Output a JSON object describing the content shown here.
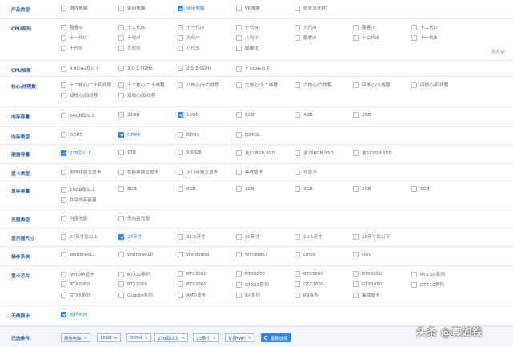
{
  "filters": [
    {
      "label": "产品类型",
      "options": [
        {
          "text": "游戏电脑",
          "checked": false
        },
        {
          "text": "家用电脑",
          "checked": false
        },
        {
          "text": "商用电脑",
          "checked": true
        },
        {
          "text": "VR电脑",
          "checked": false
        },
        {
          "text": "创意设计PC",
          "checked": false
        }
      ]
    },
    {
      "label": "CPU系列",
      "options": [
        {
          "text": "酷睿i9",
          "checked": false
        },
        {
          "text": "十二代i9",
          "checked": false
        },
        {
          "text": "十一代i9",
          "checked": false
        },
        {
          "text": "十代i9",
          "checked": false
        },
        {
          "text": "九代i9",
          "checked": false
        },
        {
          "text": "酷睿i7",
          "checked": false
        },
        {
          "text": "十二代i7",
          "checked": false
        },
        {
          "text": "十一代i7",
          "checked": false
        },
        {
          "text": "十代i7",
          "checked": false
        },
        {
          "text": "九代i7",
          "checked": false
        },
        {
          "text": "八代i7",
          "checked": false
        },
        {
          "text": "酷睿i5",
          "checked": false
        },
        {
          "text": "十二代i5",
          "checked": false
        },
        {
          "text": "十一代i5",
          "checked": false
        },
        {
          "text": "十代i5",
          "checked": false
        },
        {
          "text": "九代i5",
          "checked": false
        },
        {
          "text": "八代i5",
          "checked": false
        },
        {
          "text": "酷睿i3",
          "checked": false
        }
      ]
    },
    {
      "label": "CPU频率",
      "options": [
        {
          "text": "3.5GHz及以上",
          "checked": false
        },
        {
          "text": "3.0-3.5GHz",
          "checked": false
        },
        {
          "text": "2.5-3.0GHz",
          "checked": false
        },
        {
          "text": "2.5GHz以下",
          "checked": false
        }
      ]
    },
    {
      "label": "核心/线程数",
      "options": [
        {
          "text": "十二核心/二十四线程",
          "checked": false
        },
        {
          "text": "十二核心/二十线程",
          "checked": false
        },
        {
          "text": "八核心/十六线程",
          "checked": false
        },
        {
          "text": "六核心/十二线程",
          "checked": false
        },
        {
          "text": "六核心/六线程",
          "checked": false
        },
        {
          "text": "四核心/八线程",
          "checked": false
        },
        {
          "text": "四核心/四线程",
          "checked": false
        },
        {
          "text": "双核心/四线程",
          "checked": false
        },
        {
          "text": "双核心/双线程",
          "checked": false
        }
      ]
    },
    {
      "label": "内存容量",
      "options": [
        {
          "text": "64GB及以上",
          "checked": false
        },
        {
          "text": "32GB",
          "checked": false
        },
        {
          "text": "16GB",
          "checked": true
        },
        {
          "text": "8GB",
          "checked": false
        },
        {
          "text": "4GB",
          "checked": false
        },
        {
          "text": "2GB",
          "checked": false
        }
      ]
    },
    {
      "label": "内存类型",
      "options": [
        {
          "text": "DDR5",
          "checked": false
        },
        {
          "text": "DDR4",
          "checked": true
        },
        {
          "text": "DDR3",
          "checked": false
        },
        {
          "text": "DDR3L",
          "checked": false
        }
      ]
    },
    {
      "label": "硬盘容量",
      "options": [
        {
          "text": "2TB及以上",
          "checked": true
        },
        {
          "text": "1TB",
          "checked": false
        },
        {
          "text": "500GB",
          "checked": false
        },
        {
          "text": "含128GB SSD",
          "checked": false
        },
        {
          "text": "含256GB SSD",
          "checked": false
        },
        {
          "text": "含512GB SSD",
          "checked": false
        }
      ]
    },
    {
      "label": "显卡类型",
      "options": [
        {
          "text": "发烧级独立显卡",
          "checked": false
        },
        {
          "text": "性能级独立显卡",
          "checked": false
        },
        {
          "text": "入门级独立显卡",
          "checked": false
        },
        {
          "text": "集成显卡",
          "checked": false
        },
        {
          "text": "双显卡",
          "checked": false
        }
      ]
    },
    {
      "label": "显存容量",
      "options": [
        {
          "text": "10GB及以上",
          "checked": false
        },
        {
          "text": "8GB",
          "checked": false
        },
        {
          "text": "6GB",
          "checked": false
        },
        {
          "text": "4GB",
          "checked": false
        },
        {
          "text": "3GB",
          "checked": false
        },
        {
          "text": "2GB",
          "checked": false
        },
        {
          "text": "1GB",
          "checked": false
        },
        {
          "text": "共享内存容量",
          "checked": false
        }
      ]
    },
    {
      "label": "光驱类型",
      "options": [
        {
          "text": "内置光驱",
          "checked": false
        },
        {
          "text": "无内置光驱",
          "checked": false
        }
      ]
    },
    {
      "label": "显示器尺寸",
      "options": [
        {
          "text": "27英寸及以上",
          "checked": false
        },
        {
          "text": "23英寸",
          "checked": true
        },
        {
          "text": "21.5英寸",
          "checked": false
        },
        {
          "text": "20英寸",
          "checked": false
        },
        {
          "text": "19.5英寸",
          "checked": false
        },
        {
          "text": "19英寸及以下",
          "checked": false
        }
      ]
    },
    {
      "label": "操作系统",
      "options": [
        {
          "text": "Windows11",
          "checked": false
        },
        {
          "text": "Windows10",
          "checked": false
        },
        {
          "text": "Windows8",
          "checked": false
        },
        {
          "text": "Windows7",
          "checked": false
        },
        {
          "text": "Linux",
          "checked": false
        },
        {
          "text": "DOS",
          "checked": false
        }
      ]
    },
    {
      "label": "显卡芯片",
      "options": [
        {
          "text": "NVIDIA显卡",
          "checked": false
        },
        {
          "text": "RTX30系列",
          "checked": false
        },
        {
          "text": "RTX3080",
          "checked": false
        },
        {
          "text": "RTX3070",
          "checked": false
        },
        {
          "text": "RTX3060",
          "checked": false
        },
        {
          "text": "RTX3050",
          "checked": false
        },
        {
          "text": "RTX 20系列",
          "checked": false
        },
        {
          "text": "RTX2080",
          "checked": false
        },
        {
          "text": "RTX2070",
          "checked": false
        },
        {
          "text": "RTX2060",
          "checked": false
        },
        {
          "text": "GTX16系列",
          "checked": false
        },
        {
          "text": "GTX1660",
          "checked": false
        },
        {
          "text": "GTX1650",
          "checked": false
        },
        {
          "text": "GTX10系列",
          "checked": false
        },
        {
          "text": "GTX5系列",
          "checked": false
        },
        {
          "text": "Quadro系列",
          "checked": false
        },
        {
          "text": "AMD显卡",
          "checked": false
        },
        {
          "text": "RX系列",
          "checked": false
        },
        {
          "text": "R9系列",
          "checked": false
        },
        {
          "text": "集成显卡",
          "checked": false
        }
      ]
    },
    {
      "label": "无线网卡",
      "options": [
        {
          "text": "支持WiFi",
          "checked": true
        }
      ]
    }
  ],
  "more_label": "更多",
  "selected": {
    "label": "已选条件",
    "chips": [
      "商用电脑",
      "16GB",
      "DDR4",
      "2TB及以上",
      "23英寸",
      "支持WiFi"
    ],
    "reset_label": "重新选择"
  },
  "watermark": "头条 @真如铁",
  "colors": {
    "accent": "#2f86e6",
    "label": "#1f5a9e"
  }
}
